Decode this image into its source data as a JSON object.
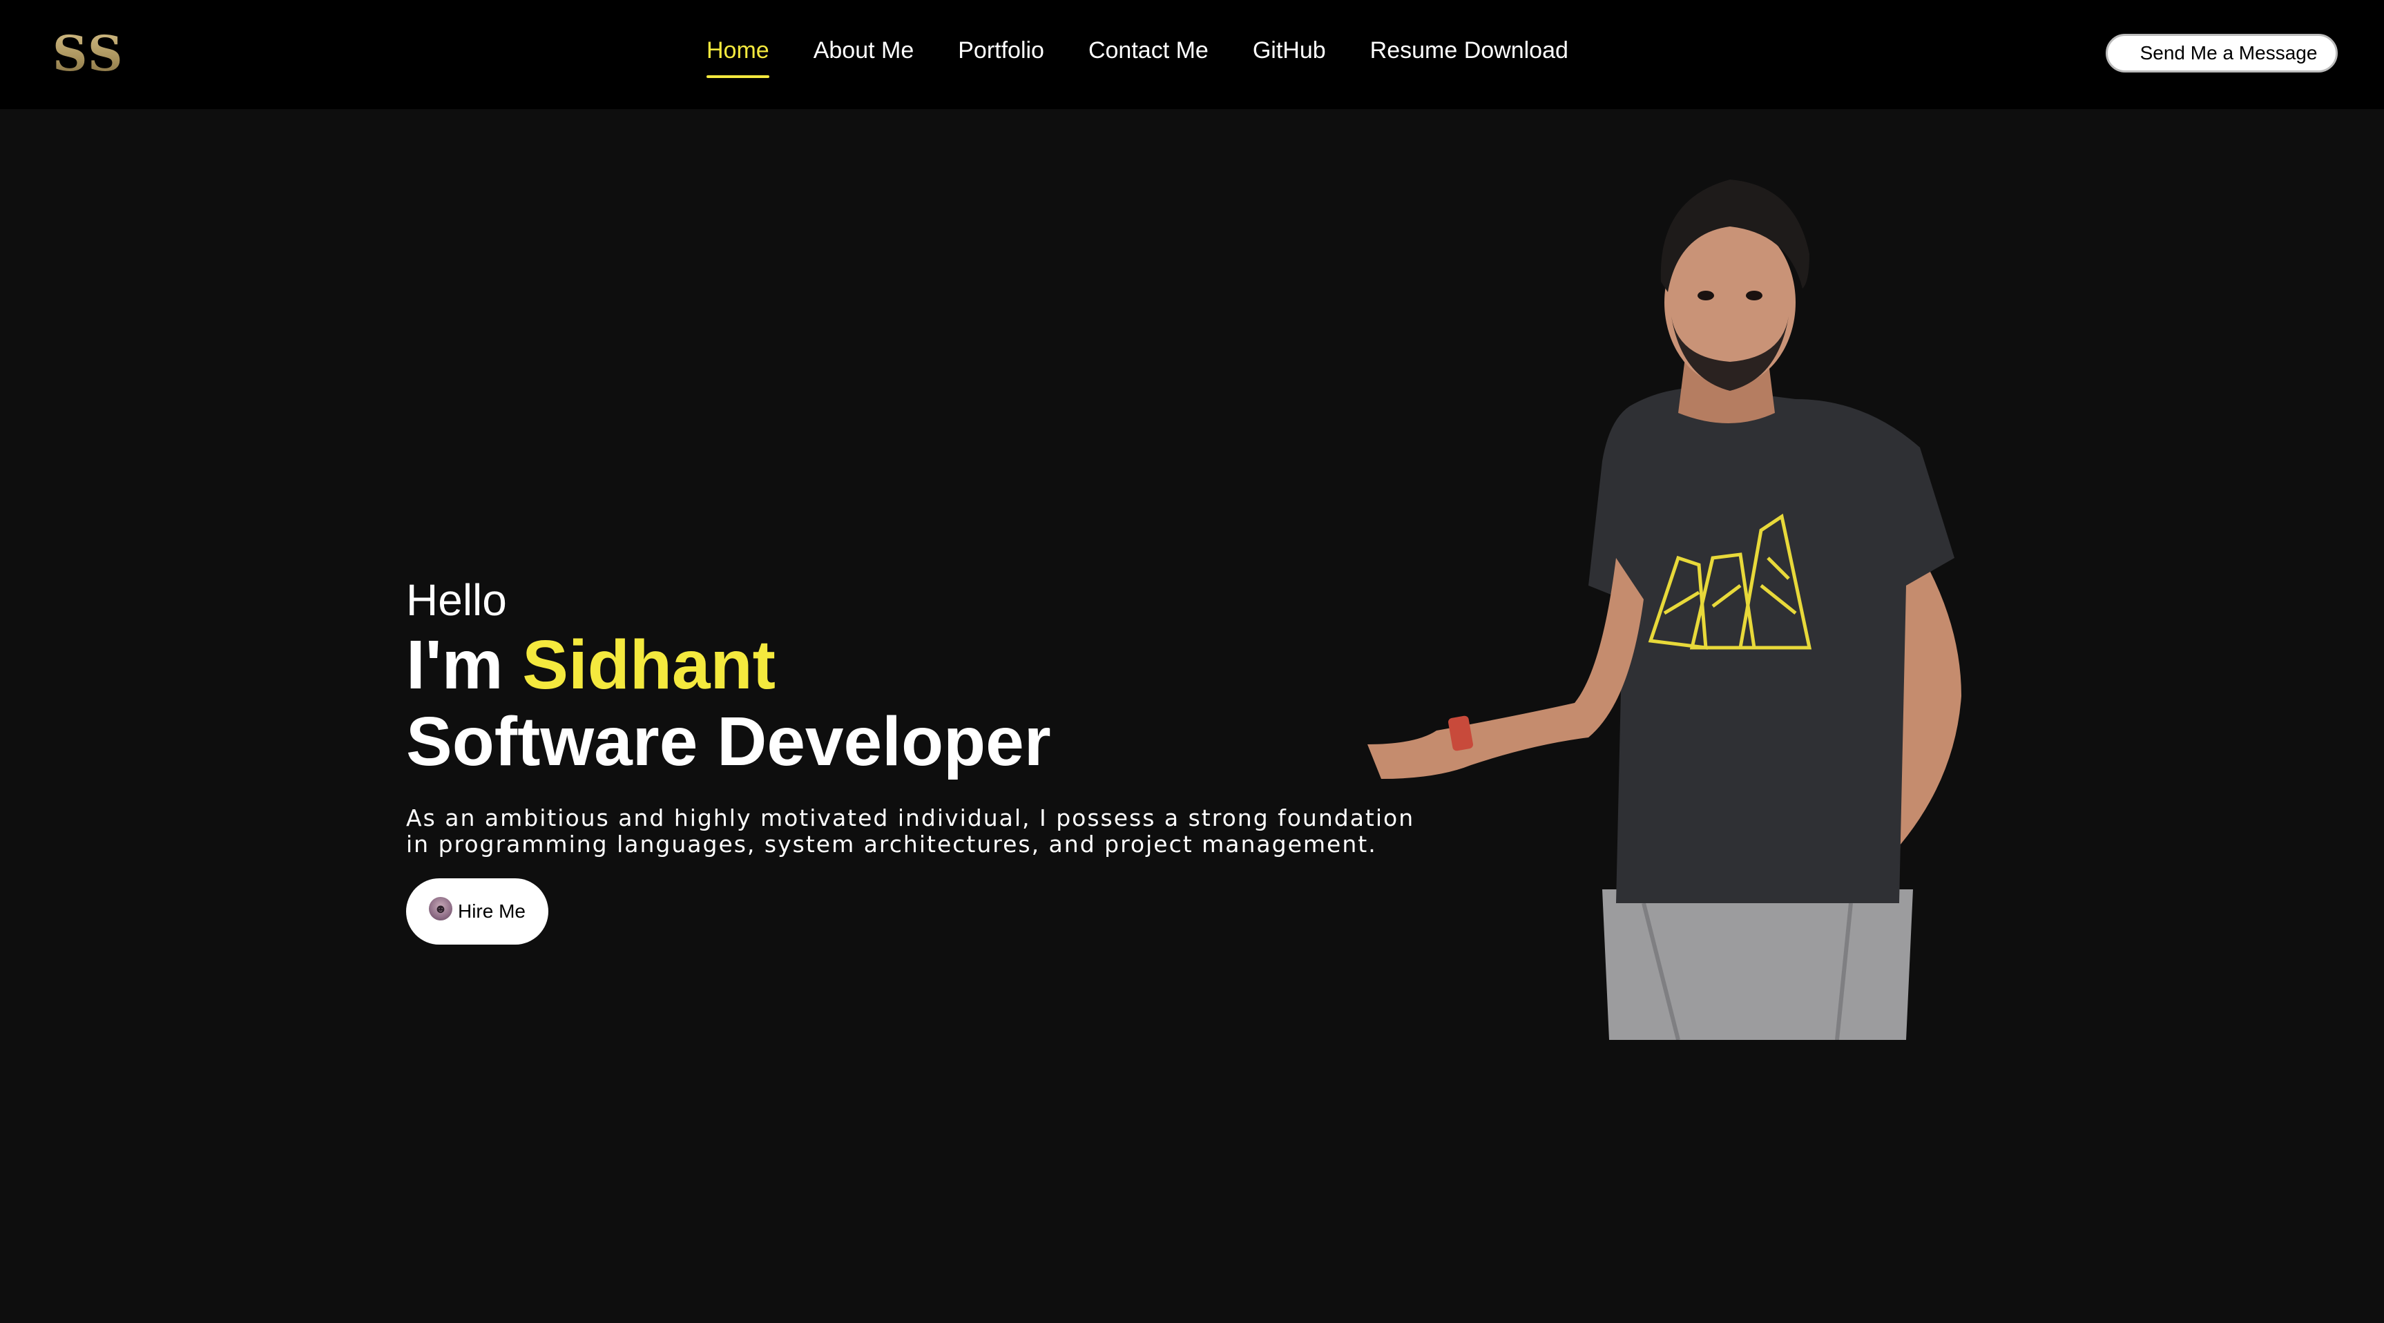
{
  "brand": {
    "logo": "SS",
    "logo_colors": [
      "#d8c28a",
      "#a8925c"
    ]
  },
  "nav": {
    "items": [
      {
        "label": "Home",
        "active": true
      },
      {
        "label": "About Me",
        "active": false
      },
      {
        "label": "Portfolio",
        "active": false
      },
      {
        "label": "Contact Me",
        "active": false
      },
      {
        "label": "GitHub",
        "active": false
      },
      {
        "label": "Resume Download",
        "active": false
      }
    ],
    "cta_label": "Send Me a Message"
  },
  "hero": {
    "greeting": "Hello",
    "intro_prefix": "I'm",
    "name": "Sidhant",
    "role": "Software Developer",
    "description": "As an ambitious and highly motivated individual, I possess a strong foundation in programming languages, system architectures, and project management.",
    "hire_label": "Hire Me",
    "hire_icon": "avatar-icon"
  },
  "colors": {
    "accent": "#f4e93e",
    "background": "#0e0e0e",
    "header": "#000000",
    "text": "#ffffff"
  },
  "portrait": {
    "subject": "person-portrait"
  }
}
